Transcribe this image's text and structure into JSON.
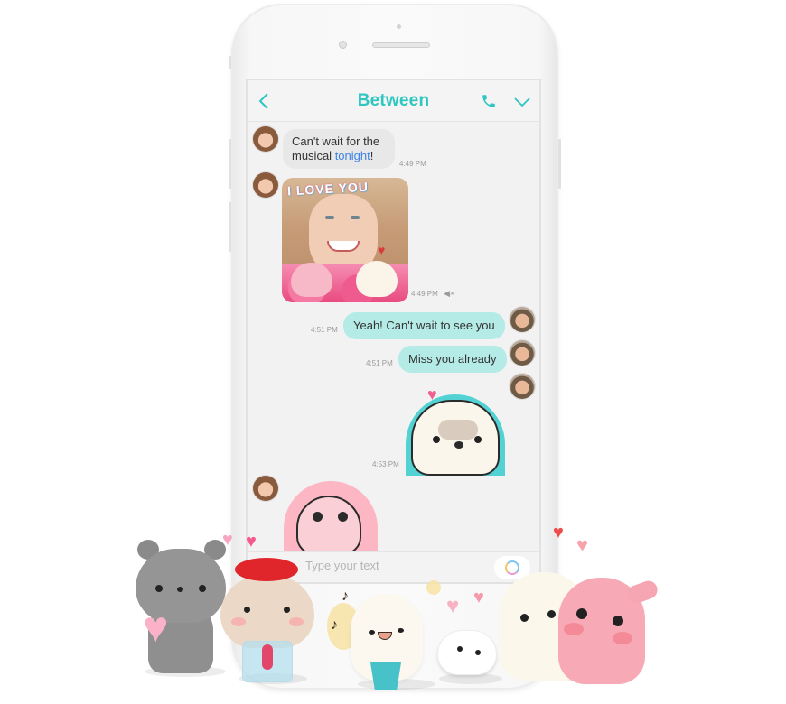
{
  "app": {
    "title": "Between",
    "accent_color": "#2fc6c0",
    "icons": {
      "back": "chevron-left-icon",
      "call": "phone-icon",
      "menu": "chevron-down-icon",
      "muted": "speaker-muted-icon",
      "emoji": "sticker-ring-icon"
    }
  },
  "messages": [
    {
      "sender": "her",
      "type": "text",
      "text_before": "Can't wait for the musical ",
      "link_text": "tonight",
      "text_after": "!",
      "time": "4:49 PM"
    },
    {
      "sender": "her",
      "type": "photo",
      "caption": "I LOVE YOU",
      "time": "4:49 PM",
      "muted": true
    },
    {
      "sender": "him",
      "type": "text",
      "text": "Yeah! Can't wait to see you",
      "time": "4:51 PM"
    },
    {
      "sender": "him",
      "type": "text",
      "text": "Miss you already",
      "time": "4:51 PM"
    },
    {
      "sender": "him",
      "type": "sticker",
      "sticker": "white-bear-sticker",
      "time": "4:53 PM"
    },
    {
      "sender": "her",
      "type": "sticker",
      "sticker": "pink-seal-sticker",
      "time": ""
    }
  ],
  "input": {
    "placeholder": "Type your text"
  },
  "decor": {
    "heart": "♥",
    "note": "♪"
  }
}
